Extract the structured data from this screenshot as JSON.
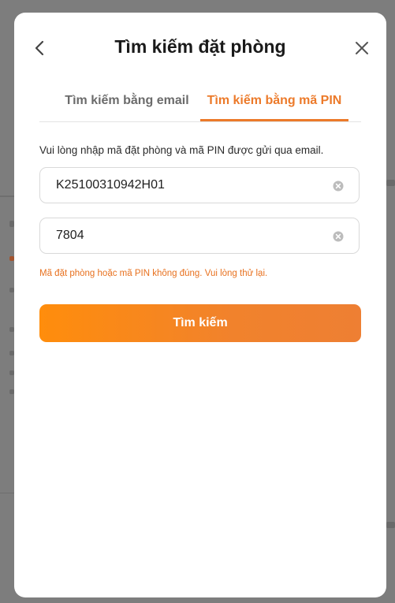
{
  "modal": {
    "title": "Tìm kiếm đặt phòng",
    "back_icon": "chevron-left-icon",
    "close_icon": "close-icon"
  },
  "tabs": [
    {
      "label": "Tìm kiếm bằng email",
      "active": false
    },
    {
      "label": "Tìm kiếm bằng mã PIN",
      "active": true
    }
  ],
  "form": {
    "instruction": "Vui lòng nhập mã đặt phòng và mã PIN được gửi qua email.",
    "booking_code": {
      "value": "K25100310942H01",
      "clear_icon": "clear-circle-icon"
    },
    "pin": {
      "value": "7804",
      "clear_icon": "clear-circle-icon"
    },
    "error": "Mã đặt phòng hoặc mã PIN không đúng. Vui lòng thử lại.",
    "submit_label": "Tìm kiếm"
  },
  "colors": {
    "accent": "#ec7a2a",
    "error": "#e8711f",
    "button_start": "#ff8d0c",
    "button_end": "#ee7f33"
  }
}
